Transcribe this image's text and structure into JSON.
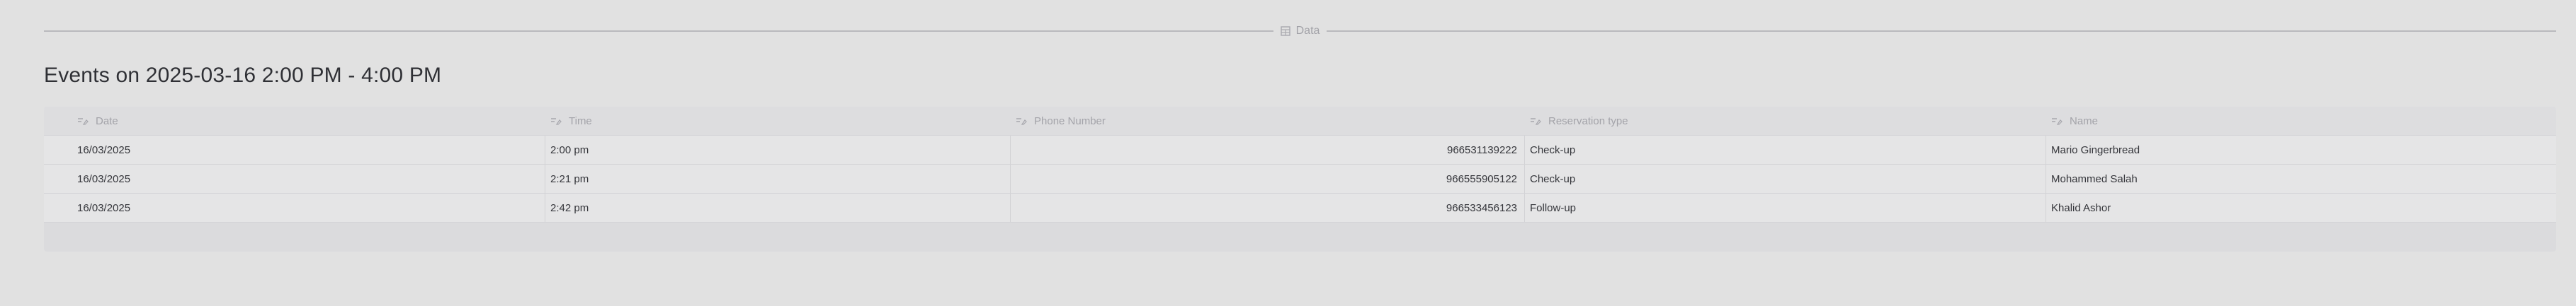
{
  "section": {
    "label": "Data",
    "icon": "table-icon"
  },
  "title": "Events on 2025-03-16 2:00 PM - 4:00 PM",
  "table": {
    "columns": [
      {
        "label": "Date",
        "icon": "text-field-icon"
      },
      {
        "label": "Time",
        "icon": "text-field-icon"
      },
      {
        "label": "Phone Number",
        "icon": "text-field-icon"
      },
      {
        "label": "Reservation type",
        "icon": "text-field-icon"
      },
      {
        "label": "Name",
        "icon": "text-field-icon"
      }
    ],
    "rows": [
      [
        "16/03/2025",
        "2:00 pm",
        "966531139222",
        "Check-up",
        "Mario Gingerbread"
      ],
      [
        "16/03/2025",
        "2:21 pm",
        "966555905122",
        "Check-up",
        "Mohammed Salah"
      ],
      [
        "16/03/2025",
        "2:42 pm",
        "966533456123",
        "Follow-up",
        "Khalid Ashor"
      ]
    ]
  }
}
